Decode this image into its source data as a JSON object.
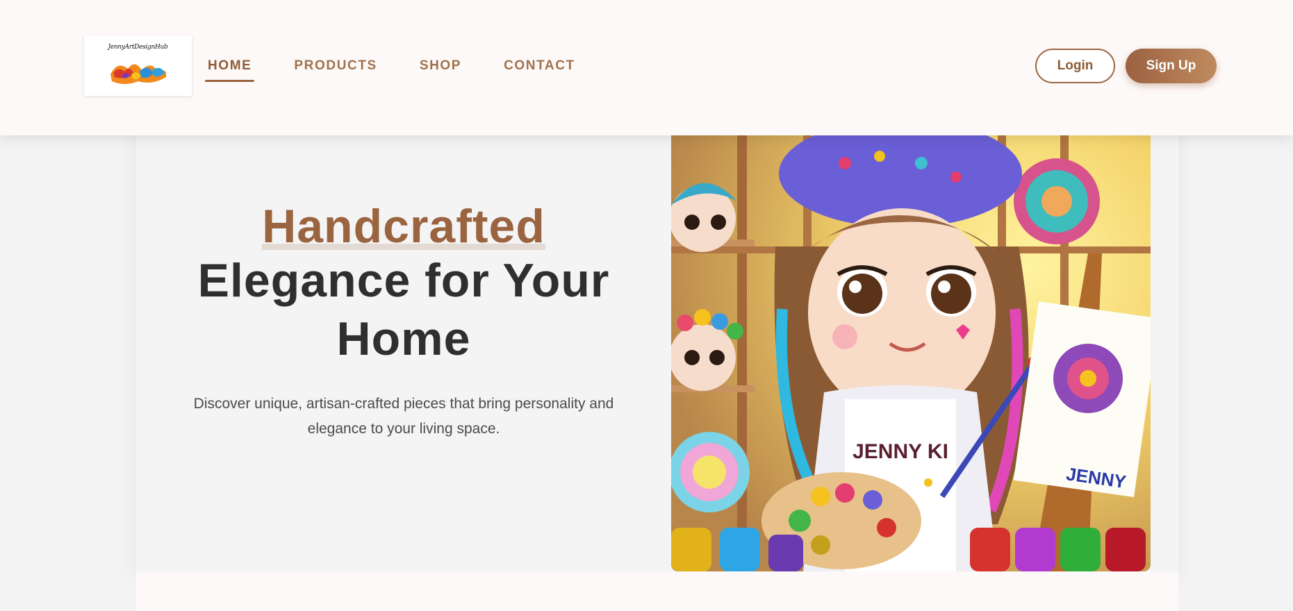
{
  "header": {
    "logo_text": "JennyArtDesignHub",
    "nav": [
      {
        "label": "HOME",
        "active": true
      },
      {
        "label": "PRODUCTS",
        "active": false
      },
      {
        "label": "SHOP",
        "active": false
      },
      {
        "label": "CONTACT",
        "active": false
      }
    ],
    "login_label": "Login",
    "signup_label": "Sign Up"
  },
  "hero": {
    "title_accent": "Handcrafted",
    "title_line2": "Elegance for Your",
    "title_line3": "Home",
    "subtitle": "Discover unique, artisan-crafted pieces that bring personality and elegance to your living space."
  },
  "illustration": {
    "apron_text": "JENNY KI",
    "canvas_text": "JENNY"
  },
  "colors": {
    "brand": "#9b6440",
    "header_bg": "#fdf9f8",
    "page_bg": "#f3f3f3",
    "heading_dark": "#2f2f2f"
  }
}
